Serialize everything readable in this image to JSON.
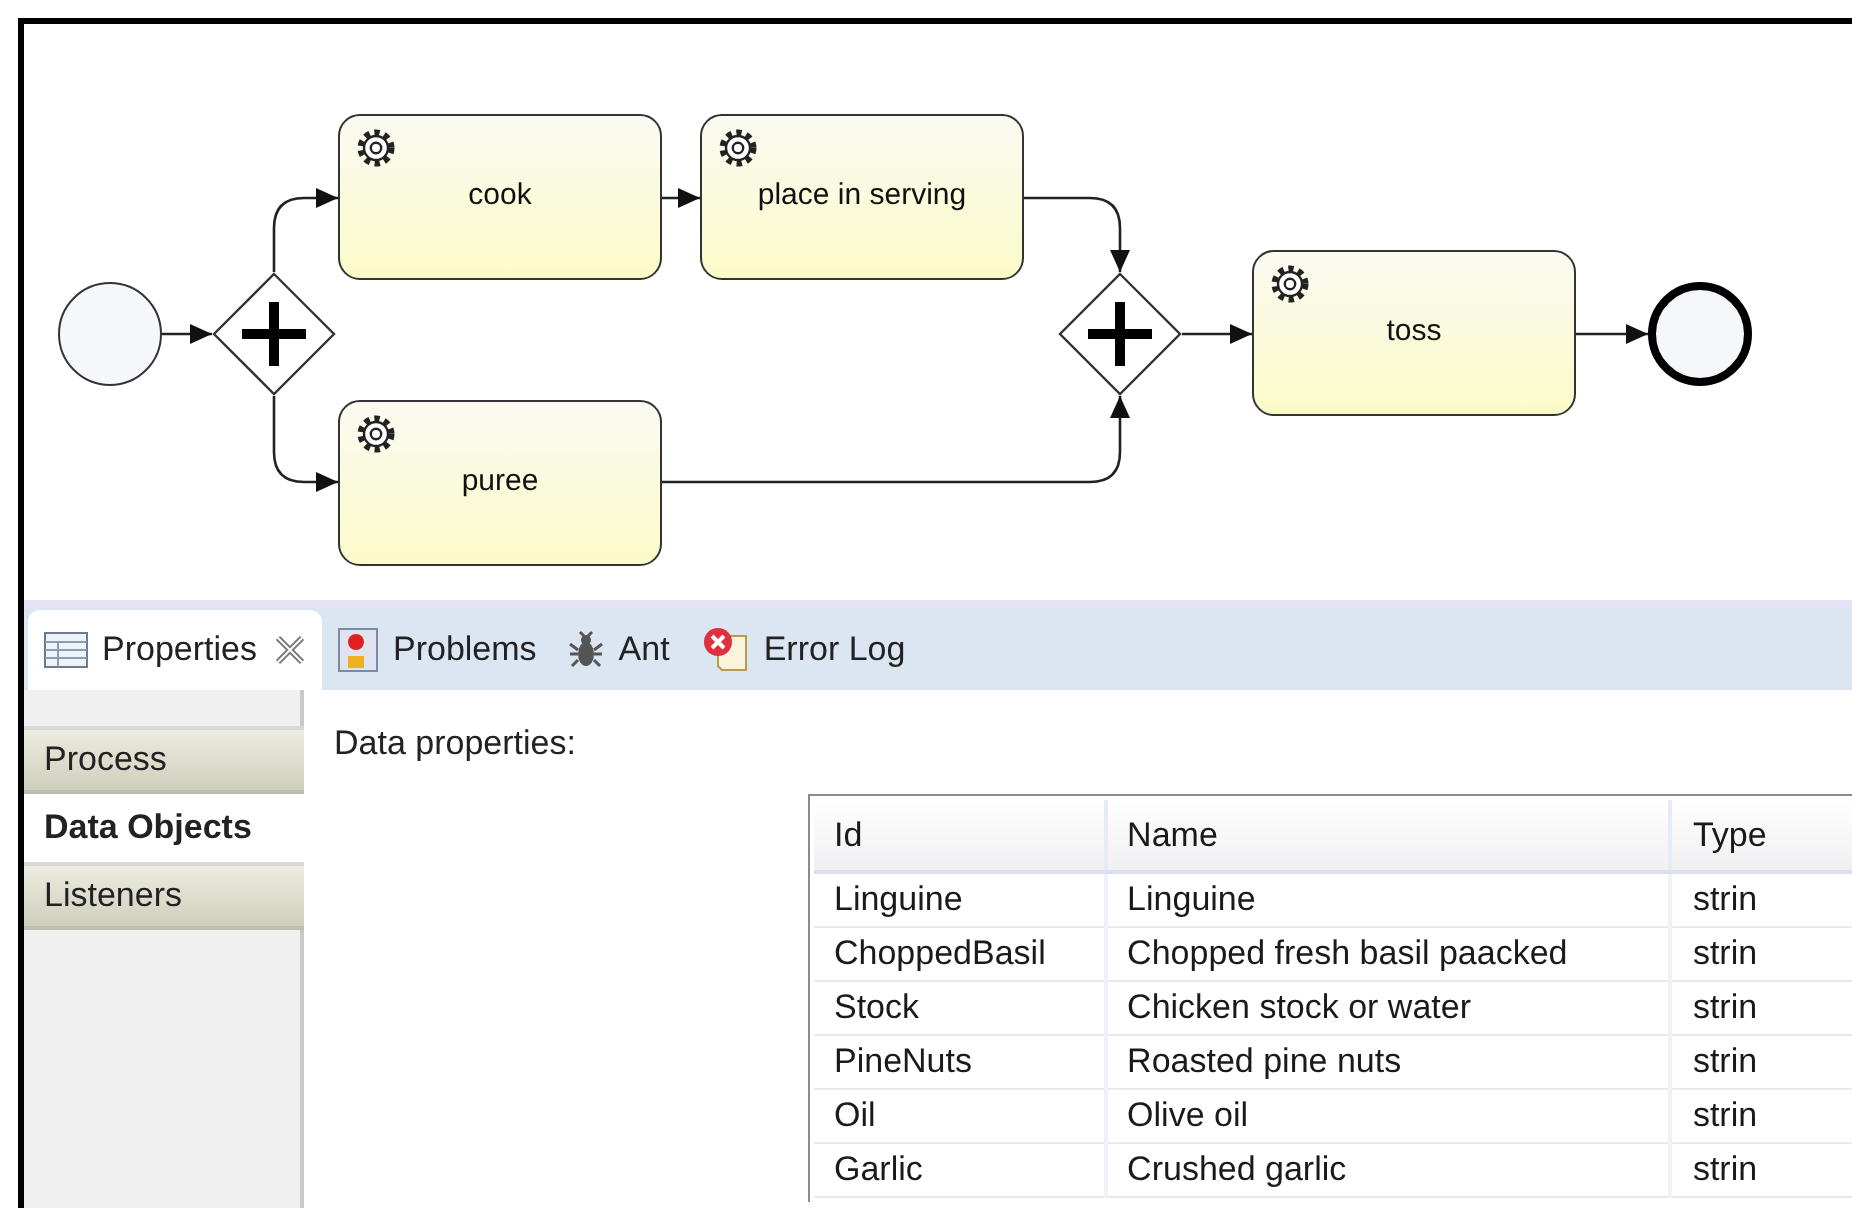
{
  "diagram": {
    "nodes": [
      {
        "kind": "start"
      },
      {
        "kind": "gateway"
      },
      {
        "kind": "task",
        "label": "cook"
      },
      {
        "kind": "task",
        "label": "place in serving"
      },
      {
        "kind": "task",
        "label": "puree"
      },
      {
        "kind": "gateway"
      },
      {
        "kind": "task",
        "label": "toss"
      },
      {
        "kind": "end"
      }
    ]
  },
  "view_tabs": [
    {
      "label": "Properties",
      "selected": true,
      "closable": true
    },
    {
      "label": "Problems",
      "selected": false,
      "closable": false
    },
    {
      "label": "Ant",
      "selected": false,
      "closable": false
    },
    {
      "label": "Error Log",
      "selected": false,
      "closable": false
    }
  ],
  "side_tabs": [
    {
      "label": "Process",
      "selected": false
    },
    {
      "label": "Data Objects",
      "selected": true
    },
    {
      "label": "Listeners",
      "selected": false
    }
  ],
  "section_label": "Data properties:",
  "table": {
    "columns": [
      "Id",
      "Name",
      "Type"
    ],
    "rows": [
      [
        "Linguine",
        "Linguine",
        "strin"
      ],
      [
        "ChoppedBasil",
        "Chopped fresh basil paacked",
        "strin"
      ],
      [
        "Stock",
        "Chicken stock or water",
        "strin"
      ],
      [
        "PineNuts",
        "Roasted pine nuts",
        "strin"
      ],
      [
        "Oil",
        "Olive oil",
        "strin"
      ],
      [
        "Garlic",
        "Crushed garlic",
        "strin"
      ]
    ]
  }
}
